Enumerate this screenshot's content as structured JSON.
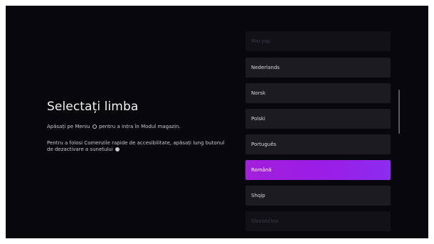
{
  "page": {
    "title": "Selectați limba",
    "hint_menu_before": "Apăsați pe Meniu",
    "hint_menu_after": "pentru a intra în Modul magazin.",
    "hint_access_before": "Pentru a folosi Comenzile rapide de accesibilitate, apăsați lung butonul de dezactivare a sunetului",
    "icons": {
      "menu": "menu-button-icon",
      "mute": "mute-button-icon"
    }
  },
  "languages": {
    "items": [
      {
        "label": "Магуар",
        "state": "faded"
      },
      {
        "label": "Nederlands",
        "state": "normal"
      },
      {
        "label": "Norsk",
        "state": "normal"
      },
      {
        "label": "Polski",
        "state": "normal"
      },
      {
        "label": "Português",
        "state": "normal"
      },
      {
        "label": "Română",
        "state": "selected"
      },
      {
        "label": "Shqip",
        "state": "normal"
      },
      {
        "label": "Slovenčina",
        "state": "faded"
      }
    ],
    "selected_color_start": "#a21fdc",
    "selected_color_end": "#8c2cf0"
  }
}
